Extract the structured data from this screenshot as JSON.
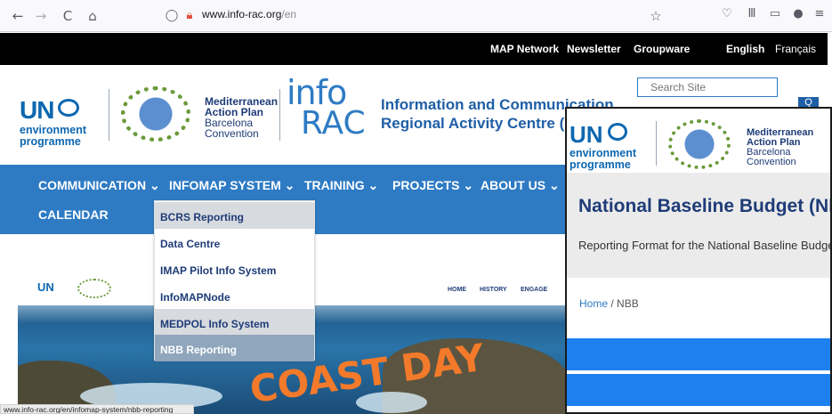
{
  "browser": {
    "url_domain": "www.info-rac.org",
    "url_path": "/en",
    "back_glyph": "←",
    "forward_glyph": "→",
    "reload_glyph": "C",
    "home_glyph": "⌂",
    "shield_glyph": "◯",
    "lock_glyph": "🔒︎",
    "star_glyph": "☆",
    "pocket_glyph": "♡",
    "library_glyph": "Ⅲ",
    "sidebar_glyph": "▭",
    "account_glyph": "●",
    "menu_glyph": "≡"
  },
  "topbar": {
    "links": [
      "MAP Network",
      "Newsletter",
      "Groupware"
    ],
    "lang_active": "English",
    "lang_other": "Français"
  },
  "header": {
    "un_big": "UN",
    "un_line1": "environment",
    "un_line2": "programme",
    "map_line1": "Mediterranean",
    "map_line2": "Action Plan",
    "map_line3": "Barcelona",
    "map_line4": "Convention",
    "info_logo": "info",
    "rac_logo": "RAC",
    "title_line1": "Information and Communication",
    "title_line2": "Regional Activity Centre (INFO/RAC)",
    "search_placeholder": "Search Site",
    "search_button": "Q"
  },
  "nav": {
    "items": [
      {
        "label": "COMMUNICATION ⌄"
      },
      {
        "label": "INFOMAP SYSTEM ⌄"
      },
      {
        "label": "TRAINING ⌄"
      },
      {
        "label": "PROJECTS ⌄"
      },
      {
        "label": "ABOUT US ⌄"
      },
      {
        "label": "CALENDAR"
      }
    ]
  },
  "dropdown": {
    "items": [
      {
        "label": "BCRS Reporting"
      },
      {
        "label": "Data Centre"
      },
      {
        "label": "IMAP Pilot Info System"
      },
      {
        "label": "InfoMAPNode"
      },
      {
        "label": "MEDPOL Info System"
      },
      {
        "label": "NBB Reporting"
      }
    ]
  },
  "preview": {
    "menu": [
      "HOME",
      "HISTORY",
      "ENGAGE"
    ],
    "coast_text": "COAST DAY"
  },
  "status_url": "www.info-rac.org/en/infomap-system/nbb-reporting",
  "overlay": {
    "title": "National Baseline Budget (NBB)",
    "subtitle": "Reporting Format for the National Baseline Budget",
    "crumb_home": "Home",
    "crumb_sep": "/",
    "crumb_current": "NBB"
  },
  "colors": {
    "brand_blue": "#2e7bc4",
    "dark_navy": "#1f3c78",
    "overlay_bar": "#1e80ef"
  }
}
